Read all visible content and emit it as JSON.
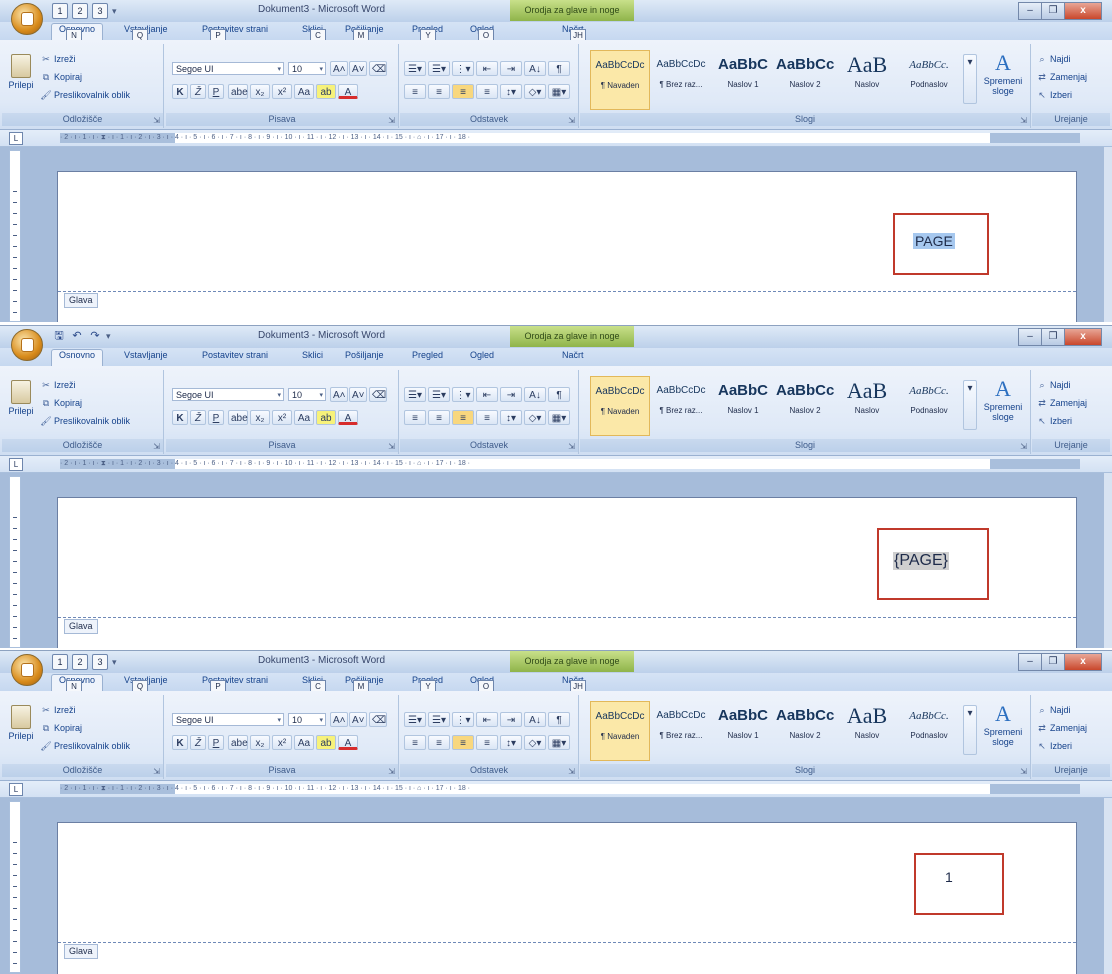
{
  "window": {
    "title": "Dokument3 - Microsoft Word",
    "context_tab": "Orodja za glave in noge"
  },
  "qat_keytips": [
    "1",
    "2",
    "3"
  ],
  "tabs": [
    {
      "label": "Osnovno",
      "keytip": "N"
    },
    {
      "label": "Vstavljanje",
      "keytip": "Q"
    },
    {
      "label": "Postavitev strani",
      "keytip": "P"
    },
    {
      "label": "Sklici",
      "keytip": "C"
    },
    {
      "label": "Pošiljanje",
      "keytip": "M"
    },
    {
      "label": "Pregled",
      "keytip": "Y"
    },
    {
      "label": "Ogled",
      "keytip": "O"
    },
    {
      "label": "Načrt",
      "keytip": "JH"
    }
  ],
  "clipboard": {
    "paste": "Prilepi",
    "cut": "Izreži",
    "copy": "Kopiraj",
    "format_painter": "Preslikovalnik oblik",
    "label": "Odložišče"
  },
  "font": {
    "name": "Segoe UI",
    "size": "10",
    "label": "Pisava",
    "bold": "K",
    "italic": "Ž",
    "underline": "P"
  },
  "paragraph": {
    "label": "Odstavek"
  },
  "styles": {
    "label": "Slogi",
    "items": [
      {
        "sample": "AaBbCcDc",
        "name": "¶ Navaden"
      },
      {
        "sample": "AaBbCcDc",
        "name": "¶ Brez raz..."
      },
      {
        "sample": "AaBbC",
        "name": "Naslov 1"
      },
      {
        "sample": "AaBbCc",
        "name": "Naslov 2"
      },
      {
        "sample": "AaB",
        "name": "Naslov"
      },
      {
        "sample": "AaBbCc.",
        "name": "Podnaslov"
      }
    ],
    "change": "Spremeni sloge"
  },
  "editing": {
    "label": "Urejanje",
    "find": "Najdi",
    "replace": "Zamenjaj",
    "select": "Izberi"
  },
  "ruler": {
    "text": "· 2 · ı · 1 · ı · ⧗ · ı · 1 · ı · 2 · ı · 3 · ı · 4 · ı · 5 · ı · 6 · ı · 7 · ı · 8 · ı · 9 · ı · 10 · ı · 11 · ı · 12 · ı · 13 · ı · 14 · ı · 15 · ı · ⌂ · ı · 17 · ı · 18 ·"
  },
  "header_label": "Glava",
  "panels": [
    {
      "field_text": "PAGE",
      "show_keytips": true
    },
    {
      "field_text": "{PAGE}",
      "show_keytips": false
    },
    {
      "field_text": "1",
      "show_keytips": true
    }
  ],
  "colors": {
    "highlight_box": "#c0392b",
    "selection": "#a6c8ef",
    "field_shading": "#cfcfcf"
  }
}
